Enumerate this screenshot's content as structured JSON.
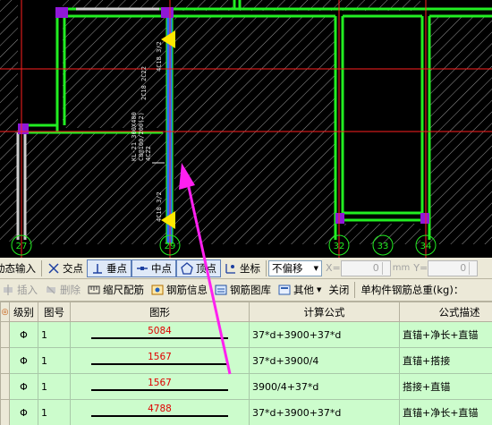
{
  "cad": {
    "axis_labels": [
      "27",
      "29",
      "32",
      "33",
      "34"
    ],
    "rebar_annotations": [
      "4C18 3/2",
      "2C18 2C22",
      "KL-21 300X400",
      "C8@100/200(2)",
      "4C22",
      "4C18 3/2"
    ]
  },
  "snap_toolbar": {
    "dynamic_input": "动态输入",
    "intersection": "交点",
    "perpendicular": "垂点",
    "midpoint": "中点",
    "vertex": "顶点",
    "coordinate": "坐标",
    "offset_mode": "不偏移",
    "x_label": "X=",
    "x_value": "0",
    "y_label": "Y=",
    "y_value": "0",
    "unit": "mm"
  },
  "edit_toolbar": {
    "insert": "插入",
    "delete": "删除",
    "scale_rebar": "缩尺配筋",
    "rebar_info": "钢筋信息",
    "rebar_library": "钢筋图库",
    "other": "其他",
    "close": "关闭",
    "total_weight_label": "单构件钢筋总重(kg)："
  },
  "table": {
    "headers": [
      "级别",
      "图号",
      "图形",
      "计算公式",
      "公式描述"
    ],
    "rows": [
      {
        "grade": "Φ",
        "fig": "1",
        "length": "5084",
        "formula": "37*d+3900+37*d",
        "desc": "直锚+净长+直锚"
      },
      {
        "grade": "Φ",
        "fig": "1",
        "length": "1567",
        "formula": "37*d+3900/4",
        "desc": "直锚+搭接"
      },
      {
        "grade": "Φ",
        "fig": "1",
        "length": "1567",
        "formula": "3900/4+37*d",
        "desc": "搭接+直锚"
      },
      {
        "grade": "Φ",
        "fig": "1",
        "length": "4788",
        "formula": "37*d+3900+37*d",
        "desc": "直锚+净长+直锚"
      }
    ]
  },
  "colors": {
    "beam_green": "#22ee22",
    "beam_blue": "#2a6cff",
    "axis_red": "#ff2020",
    "marker_yellow": "#ffe800",
    "support_purple": "#9018d8",
    "arrow_magenta": "#ff20f0",
    "row_green": "#ccfccc"
  }
}
